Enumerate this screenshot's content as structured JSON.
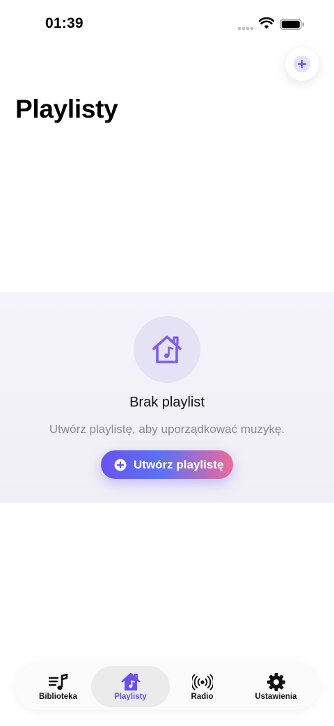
{
  "status_bar": {
    "time": "01:39"
  },
  "header": {
    "title": "Playlisty",
    "add_button_icon": "plus-icon"
  },
  "empty_state": {
    "icon": "house-music-icon",
    "title": "Brak playlist",
    "subtitle": "Utwórz playlistę, aby uporządkować muzykę.",
    "button_label": "Utwórz playlistę",
    "button_icon": "plus-circle-icon"
  },
  "tab_bar": {
    "active": "Playlisty",
    "items": [
      {
        "label": "Biblioteka",
        "icon": "music-list-icon"
      },
      {
        "label": "Playlisty",
        "icon": "house-music-icon"
      },
      {
        "label": "Radio",
        "icon": "radio-waves-icon"
      },
      {
        "label": "Ustawienia",
        "icon": "gear-icon"
      }
    ]
  },
  "colors": {
    "accent": "#6a50e8",
    "gradient_start": "#6a52ee",
    "gradient_mid": "#5a72f6",
    "gradient_end": "#ec6a9a",
    "panel_bg": "#f3f2f8",
    "icon_circle_bg": "#e6e2f6"
  }
}
